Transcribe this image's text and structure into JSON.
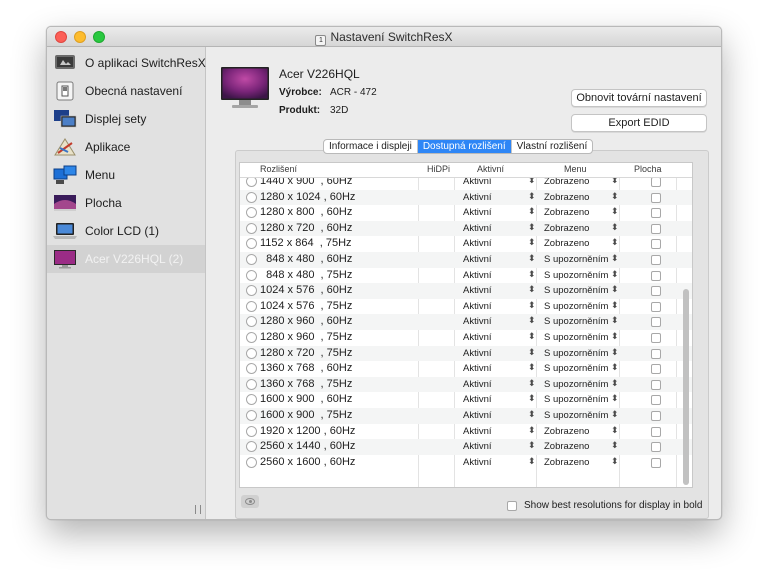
{
  "window": {
    "title": "Nastavení SwitchResX",
    "title_icon": "app-doc-icon"
  },
  "sidebar": {
    "items": [
      {
        "label": "O aplikaci SwitchResX",
        "icon": "mac-mini-icon",
        "selected": false
      },
      {
        "label": "Obecná nastavení",
        "icon": "switch-icon",
        "selected": false
      },
      {
        "label": "Displej sety",
        "icon": "display-sets-icon",
        "selected": false
      },
      {
        "label": "Aplikace",
        "icon": "application-icon",
        "selected": false
      },
      {
        "label": "Menu",
        "icon": "menu-icon",
        "selected": false
      },
      {
        "label": "Plocha",
        "icon": "desktop-icon",
        "selected": false
      },
      {
        "label": "Color LCD (1)",
        "icon": "laptop-icon",
        "selected": false
      },
      {
        "label": "Acer V226HQL (2)",
        "icon": "monitor-icon",
        "selected": true
      }
    ]
  },
  "device": {
    "name": "Acer V226HQL",
    "vendor_label": "Výrobce:",
    "vendor_value": "ACR - 472",
    "product_label": "Produkt:",
    "product_value": "32D"
  },
  "buttons": {
    "reset": "Obnovit tovární nastavení",
    "export": "Export EDID"
  },
  "tabs": [
    {
      "label": "Informace i displeji",
      "active": false
    },
    {
      "label": "Dostupná rozlišení",
      "active": true
    },
    {
      "label": "Vlastní rozlišení",
      "active": false
    }
  ],
  "table": {
    "headers": {
      "resolution": "Rozlišení",
      "hidpi": "HiDPi",
      "active": "Aktivní",
      "menu": "Menu",
      "desktop": "Plocha"
    },
    "rows": [
      {
        "res": "1440 x 900  , 60Hz",
        "active": "Aktivní",
        "menu": "Zobrazeno"
      },
      {
        "res": "1280 x 1024 , 60Hz",
        "active": "Aktivní",
        "menu": "Zobrazeno"
      },
      {
        "res": "1280 x 800  , 60Hz",
        "active": "Aktivní",
        "menu": "Zobrazeno"
      },
      {
        "res": "1280 x 720  , 60Hz",
        "active": "Aktivní",
        "menu": "Zobrazeno"
      },
      {
        "res": "1152 x 864  , 75Hz",
        "active": "Aktivní",
        "menu": "Zobrazeno"
      },
      {
        "res": "  848 x 480  , 60Hz",
        "active": "Aktivní",
        "menu": "S upozorněním"
      },
      {
        "res": "  848 x 480  , 75Hz",
        "active": "Aktivní",
        "menu": "S upozorněním"
      },
      {
        "res": "1024 x 576  , 60Hz",
        "active": "Aktivní",
        "menu": "S upozorněním"
      },
      {
        "res": "1024 x 576  , 75Hz",
        "active": "Aktivní",
        "menu": "S upozorněním"
      },
      {
        "res": "1280 x 960  , 60Hz",
        "active": "Aktivní",
        "menu": "S upozorněním"
      },
      {
        "res": "1280 x 960  , 75Hz",
        "active": "Aktivní",
        "menu": "S upozorněním"
      },
      {
        "res": "1280 x 720  , 75Hz",
        "active": "Aktivní",
        "menu": "S upozorněním"
      },
      {
        "res": "1360 x 768  , 60Hz",
        "active": "Aktivní",
        "menu": "S upozorněním"
      },
      {
        "res": "1360 x 768  , 75Hz",
        "active": "Aktivní",
        "menu": "S upozorněním"
      },
      {
        "res": "1600 x 900  , 60Hz",
        "active": "Aktivní",
        "menu": "S upozorněním"
      },
      {
        "res": "1600 x 900  , 75Hz",
        "active": "Aktivní",
        "menu": "S upozorněním"
      },
      {
        "res": "1920 x 1200 , 60Hz",
        "active": "Aktivní",
        "menu": "Zobrazeno"
      },
      {
        "res": "2560 x 1440 , 60Hz",
        "active": "Aktivní",
        "menu": "Zobrazeno"
      },
      {
        "res": "2560 x 1600 , 60Hz",
        "active": "Aktivní",
        "menu": "Zobrazeno"
      }
    ]
  },
  "footer": {
    "bold_label": "Show best resolutions for display in bold",
    "eye_icon": "eye-icon"
  },
  "colors": {
    "accent": "#2e86f6",
    "monitor_screen": "#9b2c86"
  }
}
